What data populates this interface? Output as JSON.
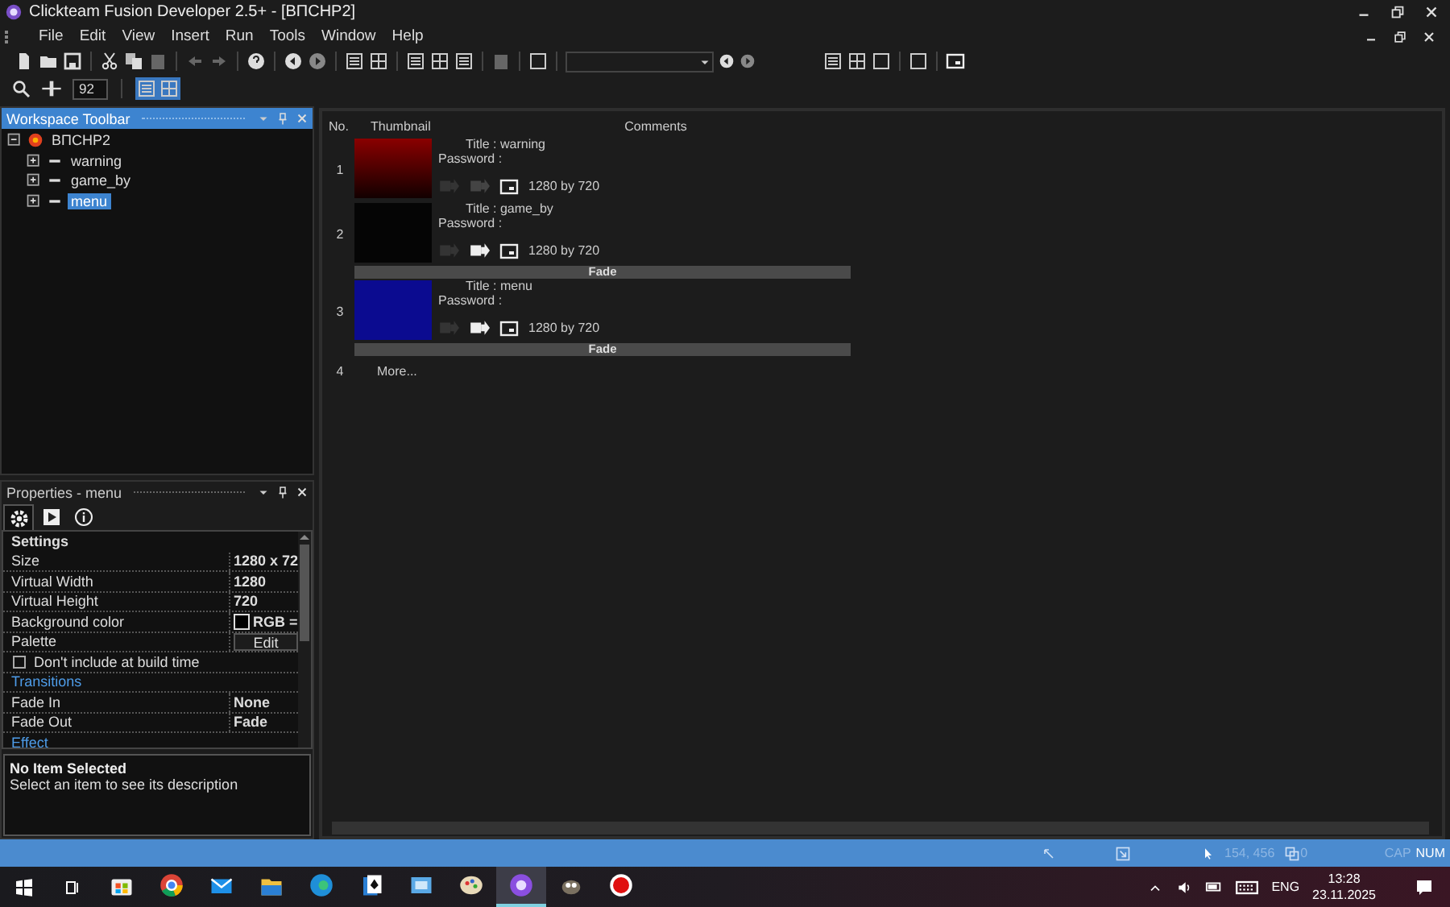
{
  "window": {
    "title": "Clickteam Fusion Developer 2.5+ - [ВПСНР2]"
  },
  "menu": [
    "File",
    "Edit",
    "View",
    "Insert",
    "Run",
    "Tools",
    "Window",
    "Help"
  ],
  "zoom": {
    "value": "92"
  },
  "workspace": {
    "title": "Workspace Toolbar",
    "root": {
      "label": "ВПСНР2",
      "expanded": true,
      "children": [
        {
          "label": "warning",
          "selected": false
        },
        {
          "label": "game_by",
          "selected": false
        },
        {
          "label": "menu",
          "selected": true
        }
      ]
    }
  },
  "storyboard": {
    "columns": [
      "No.",
      "Thumbnail",
      "Comments"
    ],
    "rows": [
      {
        "kind": "frame",
        "number": "1",
        "title": "Title : warning",
        "password": "Password :",
        "fade_in": false,
        "fade_out": false,
        "size": "1280 by  720"
      },
      {
        "kind": "frame",
        "number": "2",
        "title": "Title : game_by",
        "password": "Password :",
        "fade_in": false,
        "fade_out": true,
        "size": "1280 by  720"
      },
      {
        "kind": "transition",
        "label": "Fade"
      },
      {
        "kind": "frame",
        "number": "3",
        "title": "Title : menu",
        "password": "Password :",
        "fade_in": false,
        "fade_out": true,
        "size": "1280 by  720"
      },
      {
        "kind": "transition",
        "label": "Fade"
      },
      {
        "kind": "more",
        "number": "4",
        "label": "More..."
      }
    ]
  },
  "properties": {
    "title": "Properties - menu",
    "tabs": [
      {
        "selected": true
      },
      {
        "selected": false
      },
      {
        "selected": false
      }
    ],
    "rows": [
      {
        "kind": "header",
        "label": "Settings"
      },
      {
        "kind": "value",
        "label": "Size",
        "value": "1280 x 72"
      },
      {
        "kind": "value",
        "label": "Virtual Width",
        "value": "1280"
      },
      {
        "kind": "value",
        "label": "Virtual Height",
        "value": "720"
      },
      {
        "kind": "color",
        "label": "Background color",
        "value": "RGB ="
      },
      {
        "kind": "button",
        "label": "Palette",
        "value": "Edit"
      },
      {
        "kind": "checkbox",
        "label": "Don't include at build time",
        "checked": false
      },
      {
        "kind": "section",
        "label": "Transitions"
      },
      {
        "kind": "value",
        "label": "Fade In",
        "value": "None"
      },
      {
        "kind": "value",
        "label": "Fade Out",
        "value": "Fade"
      },
      {
        "kind": "section",
        "label": "Effect"
      }
    ],
    "description": {
      "title": "No Item Selected",
      "text": "Select an item to see its description"
    }
  },
  "status_bar": {
    "coords": "154, 456",
    "count": "0",
    "keys": [
      {
        "label": "CAP",
        "on": false
      },
      {
        "label": "NUM",
        "on": true
      }
    ]
  },
  "taskbar": {
    "apps": [
      {
        "active": false
      },
      {
        "active": false
      },
      {
        "active": false
      },
      {
        "active": false
      },
      {
        "active": false
      },
      {
        "active": false
      },
      {
        "active": false
      },
      {
        "active": false
      },
      {
        "active": true
      },
      {
        "active": false
      },
      {
        "active": false
      }
    ],
    "language": "ENG",
    "time": "13:28",
    "date": "23.11.2025"
  }
}
